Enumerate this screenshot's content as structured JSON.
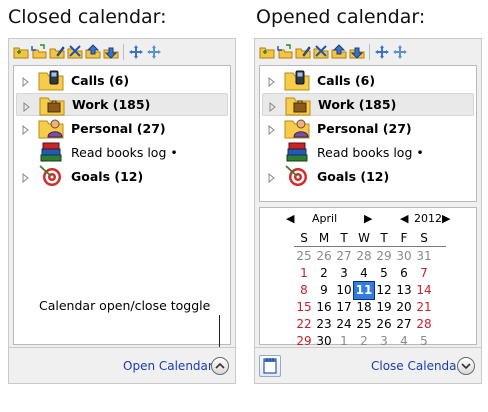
{
  "left": {
    "heading": "Closed calendar:",
    "tree": [
      {
        "label": "Calls (6)",
        "bold": true,
        "icon": "phone-folder-icon"
      },
      {
        "label": "Work (185)",
        "bold": true,
        "icon": "briefcase-folder-icon",
        "selected": true
      },
      {
        "label": "Personal (27)",
        "bold": true,
        "icon": "person-folder-icon"
      },
      {
        "label": "Read books log •",
        "bold": false,
        "icon": "books-icon"
      },
      {
        "label": "Goals (12)",
        "bold": true,
        "icon": "target-icon"
      }
    ],
    "annotation": "Calendar open/close toggle",
    "toggle_label": "Open Calendar"
  },
  "right": {
    "heading": "Opened calendar:",
    "tree": [
      {
        "label": "Calls (6)",
        "bold": true,
        "icon": "phone-folder-icon"
      },
      {
        "label": "Work (185)",
        "bold": true,
        "icon": "briefcase-folder-icon",
        "selected": true
      },
      {
        "label": "Personal (27)",
        "bold": true,
        "icon": "person-folder-icon"
      },
      {
        "label": "Read books log •",
        "bold": false,
        "icon": "books-icon"
      },
      {
        "label": "Goals (12)",
        "bold": true,
        "icon": "target-icon"
      }
    ],
    "calendar": {
      "month": "April",
      "year": "2012",
      "weekdays": [
        "S",
        "M",
        "T",
        "W",
        "T",
        "F",
        "S"
      ],
      "weeks": [
        [
          "25",
          "26",
          "27",
          "28",
          "29",
          "30",
          "31"
        ],
        [
          "1",
          "2",
          "3",
          "4",
          "5",
          "6",
          "7"
        ],
        [
          "8",
          "9",
          "10",
          "11",
          "12",
          "13",
          "14"
        ],
        [
          "15",
          "16",
          "17",
          "18",
          "19",
          "20",
          "21"
        ],
        [
          "22",
          "23",
          "24",
          "25",
          "26",
          "27",
          "28"
        ],
        [
          "29",
          "30",
          "1",
          "2",
          "3",
          "4",
          "5"
        ]
      ],
      "today": "11"
    },
    "toggle_label": "Close Calendar"
  },
  "toolbar_icons": [
    "new-folder-icon",
    "new-subfolder-icon",
    "edit-icon",
    "delete-icon",
    "move-up-icon",
    "move-down-icon",
    "expand-all-icon",
    "collapse-all-icon"
  ],
  "colors": {
    "link": "#1a3cb0",
    "weekend": "#c8202a",
    "today": "#2f7de0",
    "other_month": "#8a8a8a"
  }
}
